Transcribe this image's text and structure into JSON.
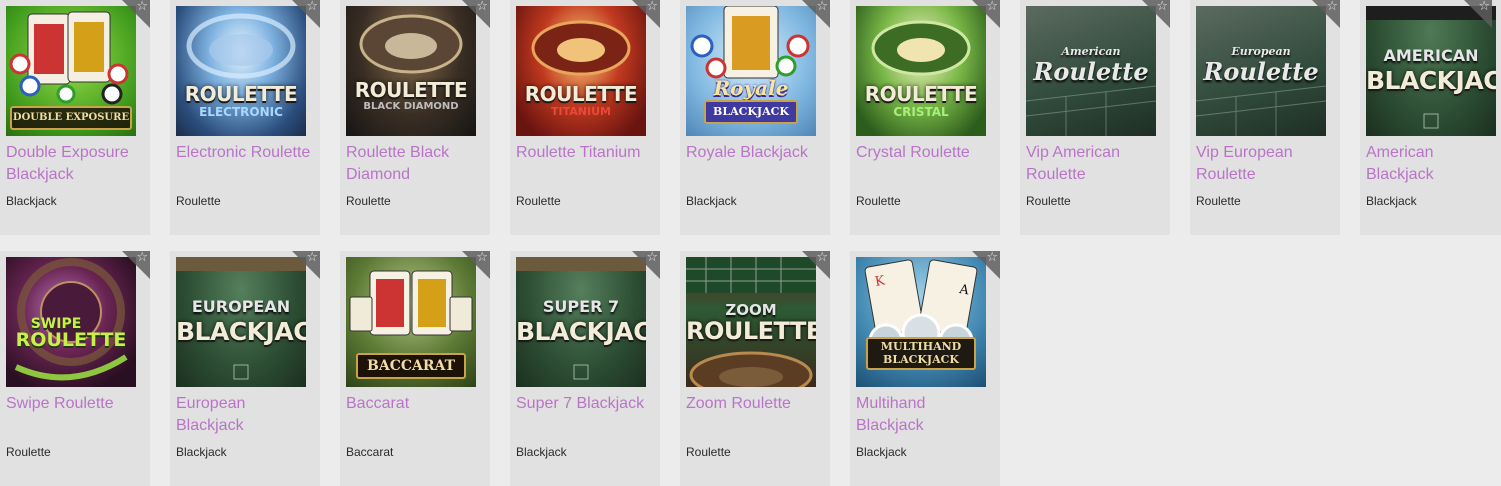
{
  "games": [
    {
      "name": "Double Exposure Blackjack",
      "category": "Blackjack",
      "thumb_text": "DOUBLE EXPOSURE",
      "theme": "green"
    },
    {
      "name": "Electronic Roulette",
      "category": "Roulette",
      "thumb_text": "ROULETTE",
      "thumb_sub": "ELECTRONIC",
      "theme": "blue"
    },
    {
      "name": "Roulette Black Diamond",
      "category": "Roulette",
      "thumb_text": "ROULETTE",
      "thumb_sub": "BLACK DIAMOND",
      "theme": "dark"
    },
    {
      "name": "Roulette Titanium",
      "category": "Roulette",
      "thumb_text": "ROULETTE",
      "thumb_sub": "TITANIUM",
      "theme": "red"
    },
    {
      "name": "Royale Blackjack",
      "category": "Blackjack",
      "thumb_text": "Royale",
      "thumb_sub": "BLACKJACK",
      "theme": "lightblue"
    },
    {
      "name": "Crystal Roulette",
      "category": "Roulette",
      "thumb_text": "ROULETTE",
      "thumb_sub": "CRISTAL",
      "theme": "greenglow"
    },
    {
      "name": "Vip American Roulette",
      "category": "Roulette",
      "thumb_text": "Roulette",
      "thumb_sub": "American",
      "theme": "table"
    },
    {
      "name": "Vip European Roulette",
      "category": "Roulette",
      "thumb_text": "Roulette",
      "thumb_sub": "European",
      "theme": "table"
    },
    {
      "name": "American Blackjack",
      "category": "Blackjack",
      "thumb_text": "BLACKJACK",
      "thumb_sub": "AMERICAN",
      "theme": "felt"
    },
    {
      "name": "Swipe Roulette",
      "category": "Roulette",
      "thumb_text": "ROULETTE",
      "thumb_sub": "SWIPE",
      "theme": "purple"
    },
    {
      "name": "European Blackjack",
      "category": "Blackjack",
      "thumb_text": "BLACKJACK",
      "thumb_sub": "EUROPEAN",
      "theme": "felt"
    },
    {
      "name": "Baccarat",
      "category": "Baccarat",
      "thumb_text": "BACCARAT",
      "theme": "baccarat"
    },
    {
      "name": "Super 7 Blackjack",
      "category": "Blackjack",
      "thumb_text": "BLACKJACK",
      "thumb_sub": "SUPER 7",
      "theme": "felt"
    },
    {
      "name": "Zoom Roulette",
      "category": "Roulette",
      "thumb_text": "ROULETTE",
      "thumb_sub": "ZOOM",
      "theme": "zoom"
    },
    {
      "name": "Multihand Blackjack",
      "category": "Blackjack",
      "thumb_text": "BLACKJACK",
      "thumb_sub": "MULTIHAND",
      "theme": "multihand"
    }
  ],
  "favorite_icon": "star-outline-icon",
  "colors": {
    "name_link": "#b974c8",
    "card_bg": "#e1e1e1",
    "page_bg": "#ececec"
  }
}
